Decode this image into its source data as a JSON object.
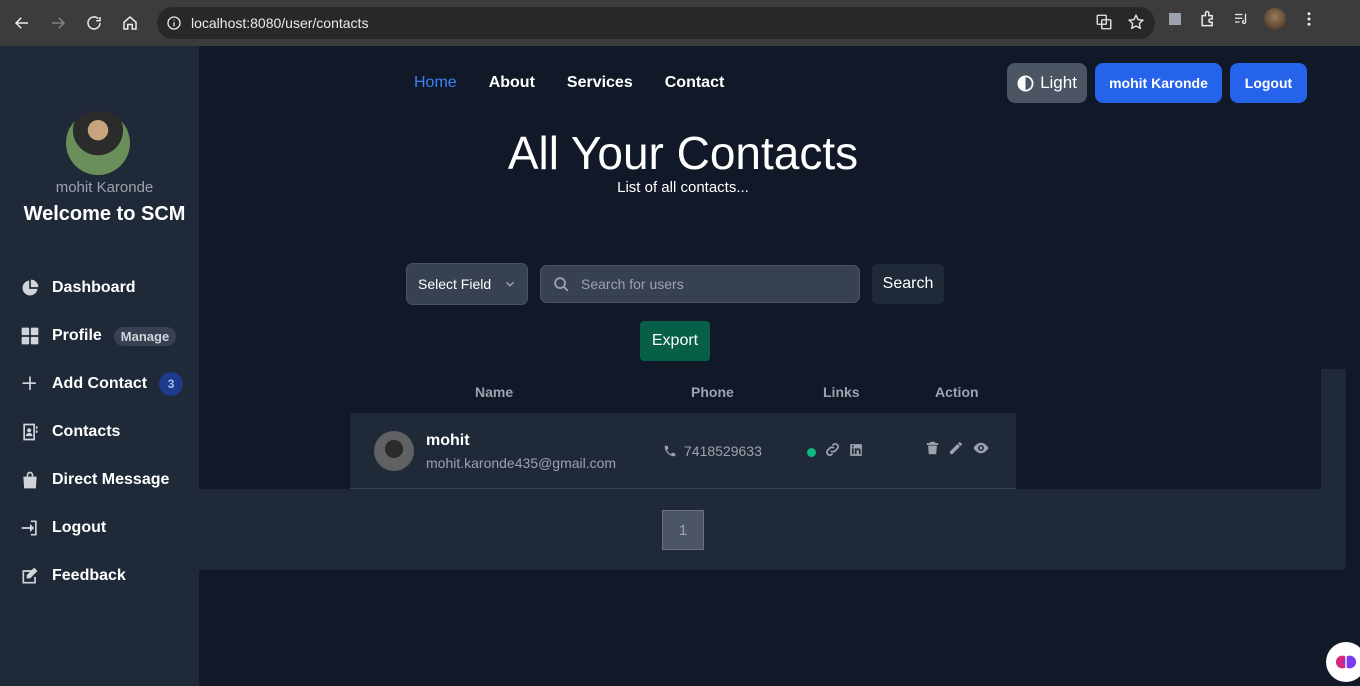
{
  "browser": {
    "url": "localhost:8080/user/contacts"
  },
  "sidebar": {
    "user_name": "mohit Karonde",
    "welcome": "Welcome to SCM",
    "items": [
      {
        "label": "Dashboard",
        "icon": "pie-chart-icon"
      },
      {
        "label": "Profile",
        "icon": "grid-icon",
        "badge": "Manage"
      },
      {
        "label": "Add Contact",
        "icon": "plus-icon",
        "count": "3"
      },
      {
        "label": "Contacts",
        "icon": "address-book-icon"
      },
      {
        "label": "Direct Message",
        "icon": "bag-icon"
      },
      {
        "label": "Logout",
        "icon": "logout-icon"
      },
      {
        "label": "Feedback",
        "icon": "feedback-icon"
      }
    ]
  },
  "topnav": {
    "items": [
      "Home",
      "About",
      "Services",
      "Contact"
    ],
    "theme_button": "Light",
    "user_button": "mohit Karonde",
    "logout_button": "Logout"
  },
  "page": {
    "title": "All Your Contacts",
    "subtitle": "List of all contacts..."
  },
  "search": {
    "select_label": "Select Field",
    "placeholder": "Search for users",
    "button": "Search",
    "export_button": "Export"
  },
  "table": {
    "headers": [
      "Name",
      "Phone",
      "Links",
      "Action"
    ],
    "rows": [
      {
        "name": "mohit",
        "email": "mohit.karonde435@gmail.com",
        "phone": "7418529633"
      }
    ]
  },
  "pagination": {
    "current": "1"
  },
  "colors": {
    "background": "#111827",
    "sidebar": "#1f2937",
    "primary": "#2563eb",
    "active_link": "#3b82f6",
    "export": "#065f46",
    "status_dot": "#10b981"
  }
}
